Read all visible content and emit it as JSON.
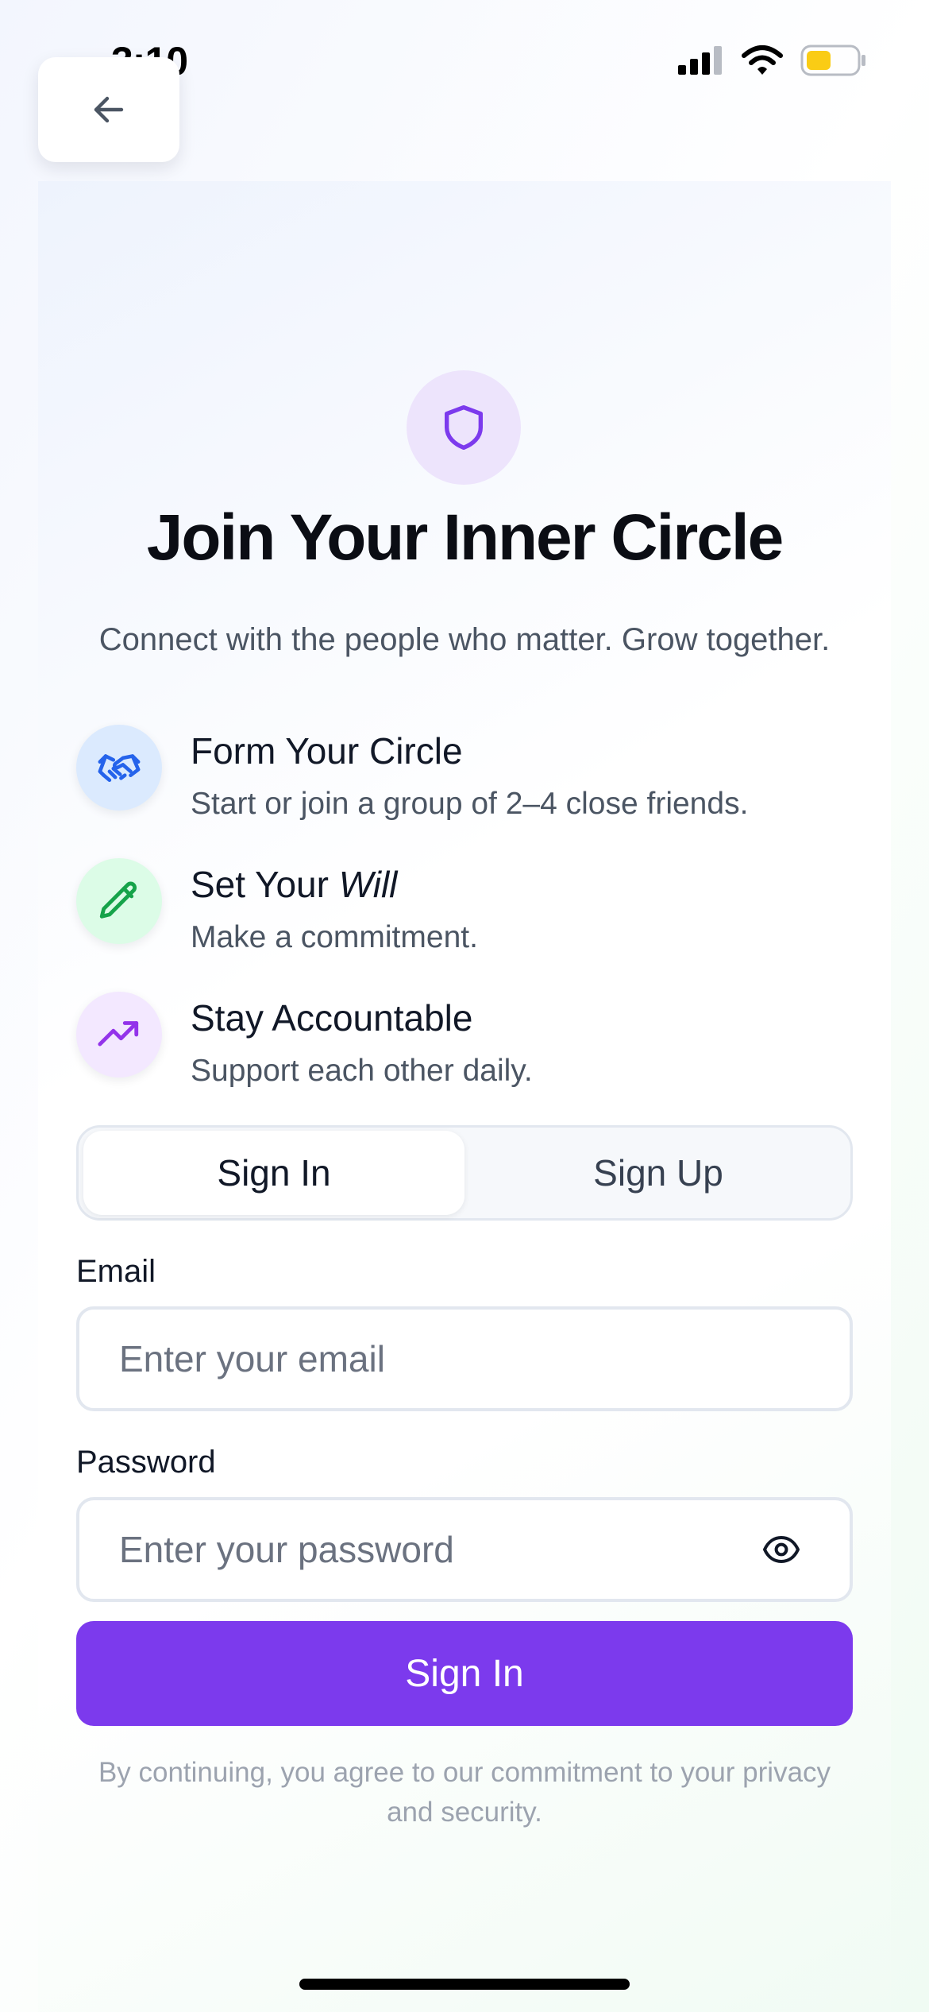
{
  "status_bar": {
    "time": "3:10",
    "battery_level": 0.5,
    "battery_color": "#facc15"
  },
  "header": {
    "back_icon": "arrow-left-icon"
  },
  "hero": {
    "icon": "shield-icon",
    "title": "Join Your Inner Circle",
    "subtitle": "Connect with the people who matter. Grow together."
  },
  "features": [
    {
      "icon": "handshake-icon",
      "title": "Form Your Circle",
      "description": "Start or join a group of 2–4 close friends.",
      "bg": "#dbeafe",
      "color": "#2563eb"
    },
    {
      "icon": "pencil-icon",
      "title_prefix": "Set Your ",
      "title_emphasis": "Will",
      "description": "Make a commitment.",
      "bg": "#dcfce7",
      "color": "#16a34a"
    },
    {
      "icon": "trending-up-icon",
      "title": "Stay Accountable",
      "description": "Support each other daily.",
      "bg": "#f3e8ff",
      "color": "#9333ea"
    }
  ],
  "tabs": {
    "signin": "Sign In",
    "signup": "Sign Up",
    "active": "signin"
  },
  "form": {
    "email_label": "Email",
    "email_placeholder": "Enter your email",
    "email_value": "",
    "password_label": "Password",
    "password_placeholder": "Enter your password",
    "password_value": "",
    "toggle_icon": "eye-icon"
  },
  "submit": {
    "label": "Sign In",
    "color": "#7c3aed"
  },
  "terms": "By continuing, you agree to our commitment to your privacy and security.",
  "colors": {
    "accent": "#7c3aed",
    "hero_icon_bg": "#ede4fc"
  }
}
